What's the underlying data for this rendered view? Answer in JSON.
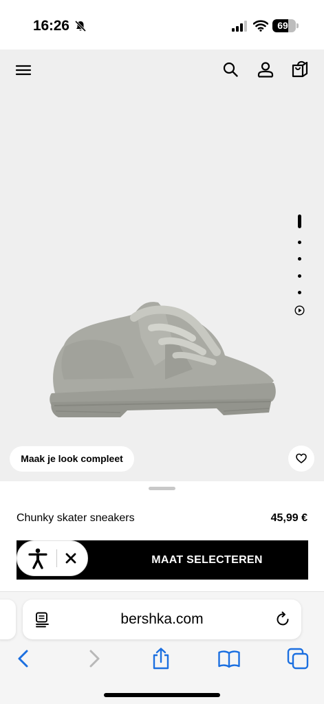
{
  "status_bar": {
    "time": "16:26",
    "battery_percent": 69,
    "battery_text": "69",
    "icons": [
      "bell-slash-icon",
      "cellular-signal-icon",
      "wifi-icon",
      "battery-icon"
    ]
  },
  "header": {
    "icons": [
      "menu-icon",
      "search-icon",
      "account-icon",
      "shopping-bag-icon"
    ]
  },
  "gallery": {
    "image": "grey chunky skater sneaker",
    "image_count": 4,
    "active_index": 0,
    "has_video": true
  },
  "look_button": {
    "label": "Maak je look compleet"
  },
  "product": {
    "name": "Chunky skater sneakers",
    "price": "45,99 €"
  },
  "size_button": {
    "label": "MAAT SELECTEREN"
  },
  "accessibility": {
    "icons": [
      "accessibility-person-icon",
      "close-icon"
    ]
  },
  "browser": {
    "url": "bershka.com",
    "toolbar_icons": [
      "back-icon",
      "forward-icon",
      "share-icon",
      "bookmarks-icon",
      "tabs-icon"
    ]
  },
  "colors": {
    "stage_background": "#efefef",
    "button_background": "#000000",
    "ios_blue": "#1b6fe0"
  }
}
